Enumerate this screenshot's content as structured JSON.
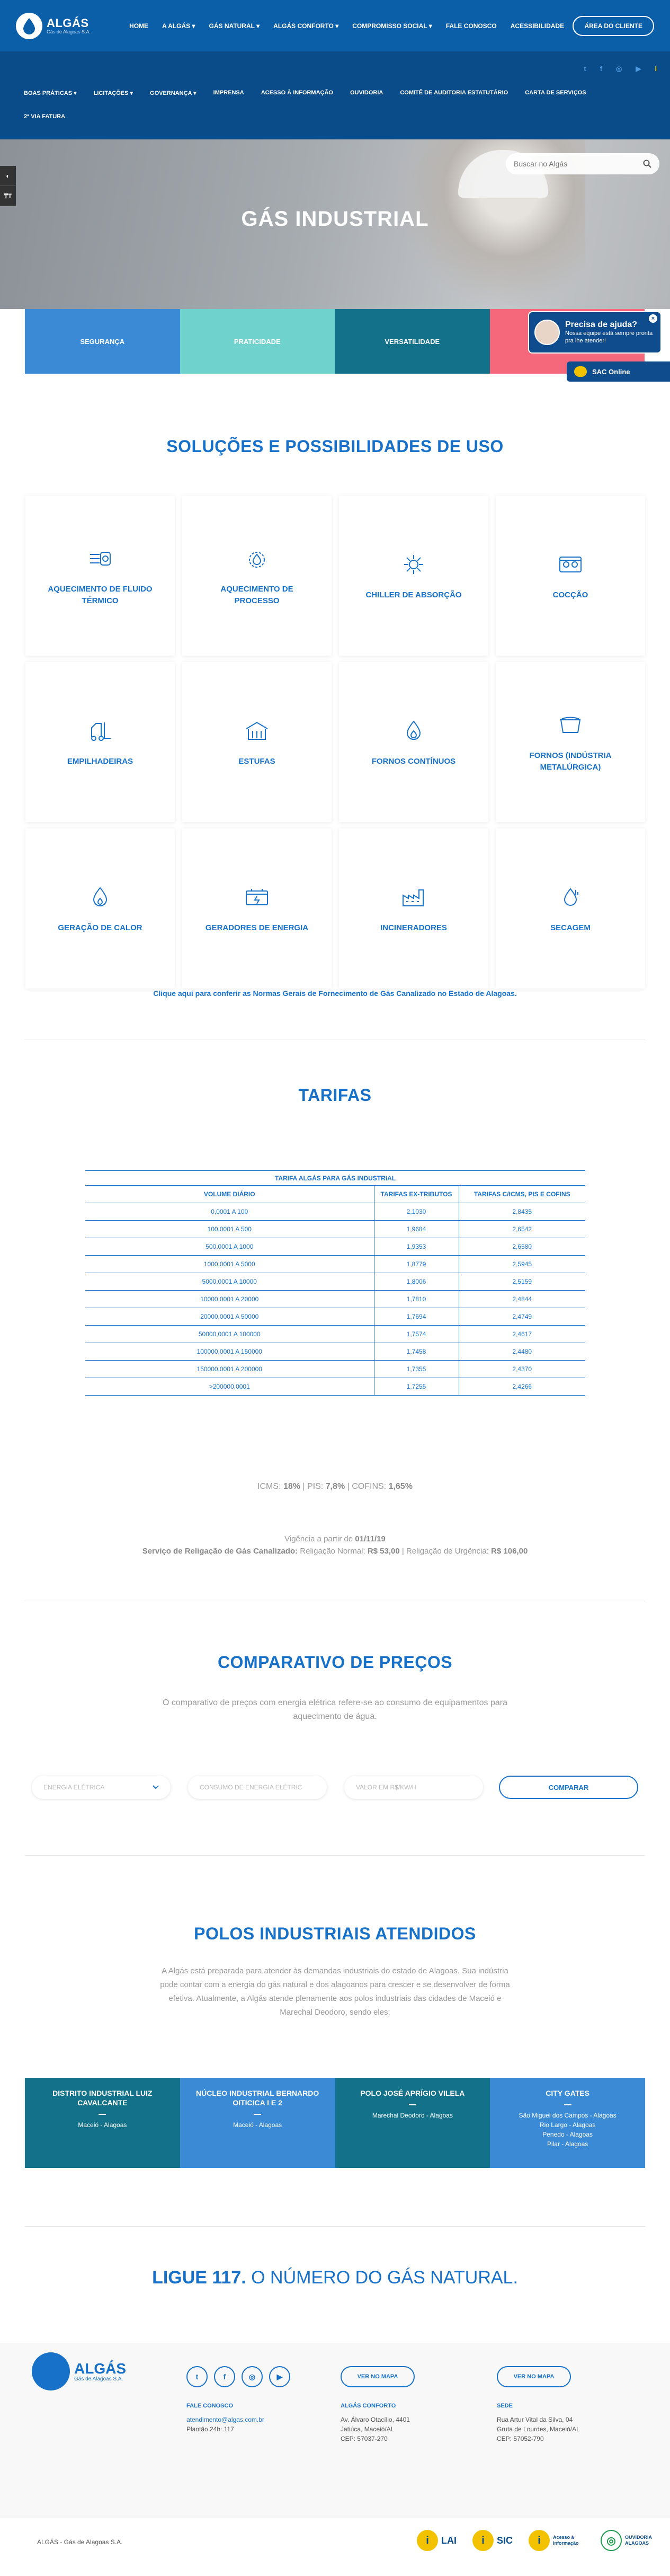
{
  "logo": {
    "name": "ALGÁS",
    "tagline": "Gás de Alagoas S.A."
  },
  "mainnav": [
    "HOME",
    "A ALGÁS ▾",
    "GÁS NATURAL ▾",
    "ALGÁS CONFORTO ▾",
    "COMPROMISSO SOCIAL ▾",
    "FALE CONOSCO",
    "ACESSIBILIDADE"
  ],
  "area_cliente": "ÁREA DO CLIENTE",
  "social_top": [
    "t",
    "f",
    "◎",
    "▶",
    "i"
  ],
  "subnav": [
    "BOAS PRÁTICAS ▾",
    "LICITAÇÕES ▾",
    "GOVERNANÇA ▾",
    "IMPRENSA",
    "ACESSO À INFORMAÇÃO",
    "OUVIDORIA",
    "COMITÊ DE AUDITORIA ESTATUTÁRIO",
    "CARTA DE SERVIÇOS",
    "2ª VIA FATURA"
  ],
  "side_tools": [
    "◐",
    "₸T"
  ],
  "search": {
    "placeholder": "Buscar no Algás"
  },
  "hero_title": "GÁS INDUSTRIAL",
  "features": [
    {
      "label": "SEGURANÇA",
      "color": "#3a8ad6"
    },
    {
      "label": "PRATICIDADE",
      "color": "#6fd2cc"
    },
    {
      "label": "VERSATILIDADE",
      "color": "#137189"
    },
    {
      "label": "ECONOMIA",
      "color": "#f5677a"
    }
  ],
  "help": {
    "title": "Precisa de ajuda?",
    "text": "Nossa equipe está sempre pronta pra lhe atender!",
    "close": "×"
  },
  "sac": "SAC Online",
  "solutions": {
    "title": "SOLUÇÕES E POSSIBILIDADES DE USO",
    "cards": [
      {
        "label": "AQUECIMENTO DE FLUIDO TÉRMICO",
        "icon": "fluid-heat-icon"
      },
      {
        "label": "AQUECIMENTO DE PROCESSO",
        "icon": "process-heat-icon"
      },
      {
        "label": "CHILLER DE ABSORÇÃO",
        "icon": "chiller-icon"
      },
      {
        "label": "COCÇÃO",
        "icon": "stove-icon"
      },
      {
        "label": "EMPILHADEIRAS",
        "icon": "forklift-icon"
      },
      {
        "label": "ESTUFAS",
        "icon": "greenhouse-icon"
      },
      {
        "label": "FORNOS CONTÍNUOS",
        "icon": "furnace-icon"
      },
      {
        "label": "FORNOS (INDÚSTRIA METALÚRGICA)",
        "icon": "crucible-icon"
      },
      {
        "label": "GERAÇÃO DE CALOR",
        "icon": "flame-icon"
      },
      {
        "label": "GERADORES DE ENERGIA",
        "icon": "generator-icon"
      },
      {
        "label": "INCINERADORES",
        "icon": "factory-icon"
      },
      {
        "label": "SECAGEM",
        "icon": "drying-icon"
      }
    ],
    "normas_link": "Clique aqui para conferir as Normas Gerais de Fornecimento de Gás Canalizado no Estado de Alagoas."
  },
  "tarifas": {
    "title": "TARIFAS",
    "caption": "TARIFA ALGÁS PARA GÁS INDUSTRIAL",
    "headers": [
      "VOLUME DIÁRIO",
      "TARIFAS EX-TRIBUTOS",
      "TARIFAS C/ICMS, PIS E COFINS"
    ],
    "rows": [
      [
        "0,0001 A 100",
        "2,1030",
        "2,8435"
      ],
      [
        "100,0001 A 500",
        "1,9684",
        "2,6542"
      ],
      [
        "500,0001 A 1000",
        "1,9353",
        "2,6580"
      ],
      [
        "1000,0001 A 5000",
        "1,8779",
        "2,5945"
      ],
      [
        "5000,0001 A 10000",
        "1,8006",
        "2,5159"
      ],
      [
        "10000,0001 A 20000",
        "1,7810",
        "2,4844"
      ],
      [
        "20000,0001 A 50000",
        "1,7694",
        "2,4749"
      ],
      [
        "50000,0001 A 100000",
        "1,7574",
        "2,4617"
      ],
      [
        "100000,0001 A 150000",
        "1,7458",
        "2,4480"
      ],
      [
        "150000,0001 A 200000",
        "1,7355",
        "2,4370"
      ],
      [
        ">200000,0001",
        "1,7255",
        "2,4266"
      ]
    ],
    "impostos": {
      "icms_label": "ICMS: ",
      "icms": "18%",
      "pis_label": " | PIS: ",
      "pis": "7,8%",
      "cofins_label": " | COFINS: ",
      "cofins": "1,65%"
    },
    "vigencia_label": "Vigência a partir de ",
    "vigencia": "01/11/19",
    "religacao_label": "Serviço de Religação de Gás Canalizado:",
    "religacao_normal_label": " Religação Normal: ",
    "religacao_normal": "R$ 53,00",
    "religacao_urgencia_label": " | Religação de Urgência: ",
    "religacao_urgencia": "R$ 106,00"
  },
  "comparativo": {
    "title": "COMPARATIVO DE PREÇOS",
    "desc": "O comparativo de preços com energia elétrica refere-se ao consumo de equipamentos para aquecimento de água.",
    "select": "ENERGIA ELÉTRICA",
    "input1_placeholder": "CONSUMO DE ENERGIA ELÉTRIC",
    "input2_placeholder": "VALOR EM R$/KW/H",
    "button": "COMPARAR"
  },
  "polos": {
    "title": "POLOS INDUSTRIAIS ATENDIDOS",
    "desc": "A Algás está preparada para atender às demandas industriais do estado de Alagoas. Sua indústria pode contar com a energia do gás natural e dos alagoanos para crescer e se desenvolver de forma efetiva. Atualmente, a Algás atende plenamente aos polos industriais das cidades de Maceió e Marechal Deodoro, sendo eles:",
    "items": [
      {
        "title": "DISTRITO INDUSTRIAL LUIZ CAVALCANTE",
        "places": "Maceió - Alagoas",
        "color": "#137189"
      },
      {
        "title": "NÚCLEO INDUSTRIAL BERNARDO OITICICA I E 2",
        "places": "Maceió - Alagoas",
        "color": "#3a8ad6"
      },
      {
        "title": "POLO JOSÉ APRÍGIO VILELA",
        "places": "Marechal Deodoro - Alagoas",
        "color": "#137189"
      },
      {
        "title": "CITY GATES",
        "places": "São Miguel dos Campos - Alagoas\nRio Largo - Alagoas\nPenedo - Alagoas\nPilar - Alagoas",
        "color": "#3a8ad6"
      }
    ]
  },
  "ligue": {
    "strong": "LIGUE 117.",
    "rest": " O NÚMERO DO GÁS NATURAL."
  },
  "footer": {
    "social": [
      "t",
      "f",
      "◎",
      "▶"
    ],
    "mapa1": "VER NO MAPA",
    "mapa2": "VER NO MAPA",
    "fale_title": "FALE CONOSCO",
    "fale_email": "atendimento@algas.com.br",
    "fale_plantao": "Plantão 24h: 117",
    "conforto_title": "ALGÁS CONFORTO",
    "conforto_addr1": "Av. Álvaro Otacílio, 4401",
    "conforto_addr2": "Jatiúca, Maceió/AL",
    "conforto_cep": "CEP: 57037-270",
    "sede_title": "SEDE",
    "sede_addr1": "Rua Artur Vital da Silva, 04",
    "sede_addr2": "Gruta de Lourdes, Maceió/AL",
    "sede_cep": "CEP: 57052-790",
    "copyright": "ALGÁS - Gás de Alagoas S.A.",
    "badges": [
      {
        "icon": "i",
        "label": "LAI"
      },
      {
        "icon": "i",
        "label": "SIC"
      },
      {
        "icon": "i",
        "label": "Acesso à Informação"
      },
      {
        "icon": "◎",
        "label": "OUVIDORIA ALAGOAS"
      }
    ]
  }
}
